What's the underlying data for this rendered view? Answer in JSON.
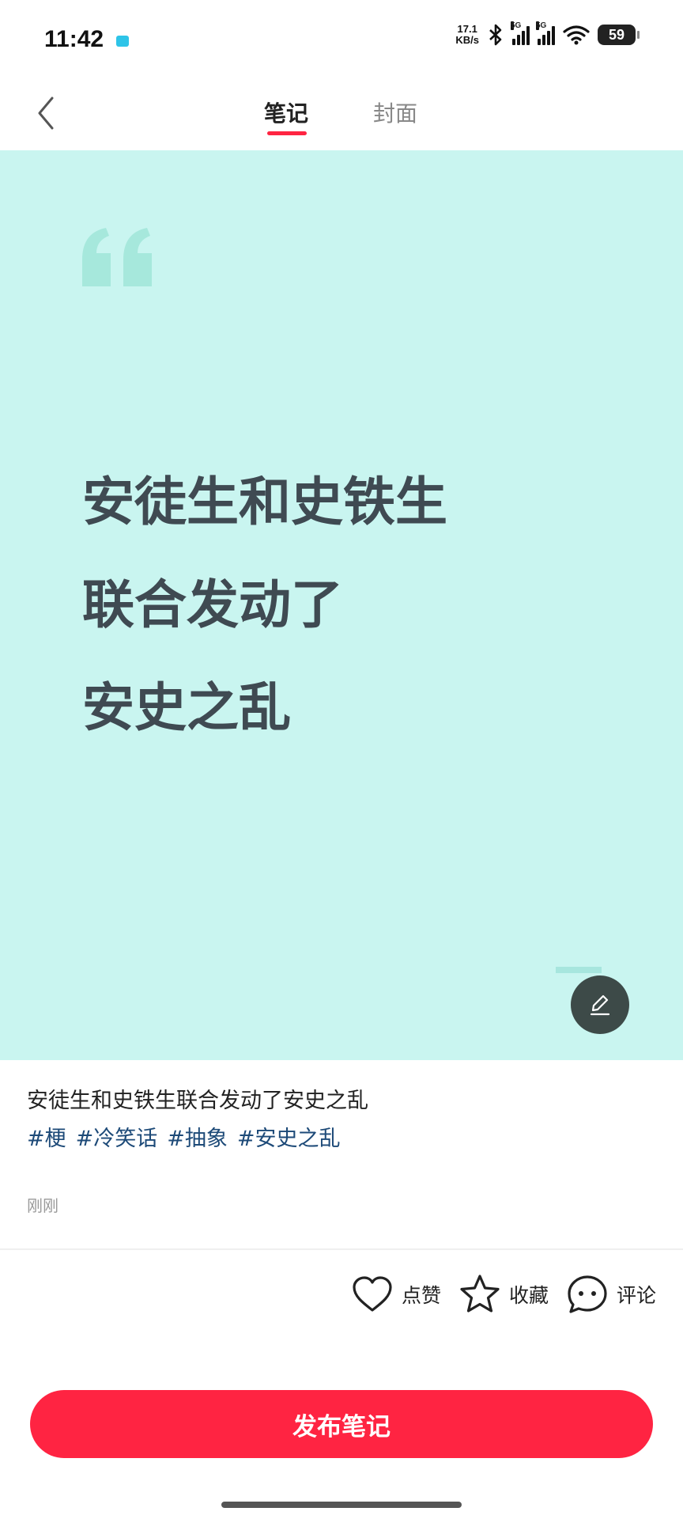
{
  "status_bar": {
    "time": "11:42",
    "net_speed_value": "17.1",
    "net_speed_unit": "KB/s",
    "sim1_tag": "5G",
    "sim2_tag": "5G",
    "battery": "59"
  },
  "nav": {
    "tabs": [
      {
        "label": "笔记",
        "active": true
      },
      {
        "label": "封面",
        "active": false
      }
    ],
    "back_icon": "chevron-left-icon"
  },
  "canvas": {
    "background": "#c9f5f0",
    "quote_lines": [
      "安徒生和史铁生",
      "联合发动了",
      "安史之乱"
    ],
    "edit_icon": "pencil-icon"
  },
  "post": {
    "caption": "安徒生和史铁生联合发动了安史之乱",
    "hashtags": [
      "#梗",
      "#冷笑话",
      "#抽象",
      "#安史之乱"
    ],
    "timestamp": "刚刚"
  },
  "actions": {
    "like": "点赞",
    "favorite": "收藏",
    "comment": "评论"
  },
  "publish_button": "发布笔记",
  "colors": {
    "accent": "#ff2442",
    "hashtag": "#1d4a78",
    "quote_text": "#3f4a52"
  }
}
